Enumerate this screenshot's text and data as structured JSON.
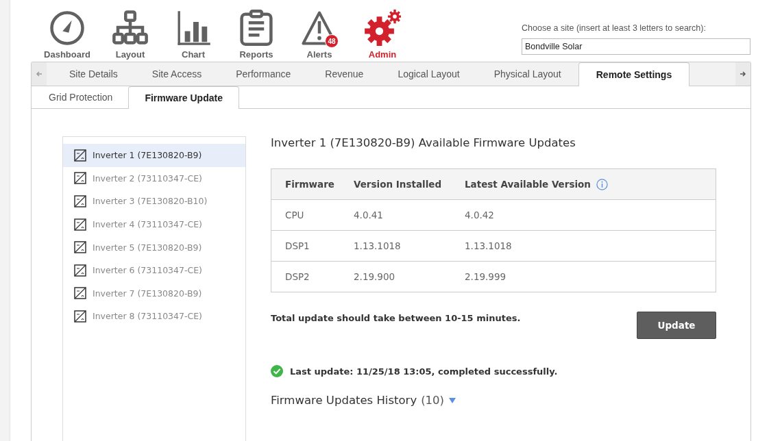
{
  "nav": [
    {
      "label": "Dashboard",
      "kind": "gauge",
      "selected": false
    },
    {
      "label": "Layout",
      "kind": "tree",
      "selected": false
    },
    {
      "label": "Chart",
      "kind": "bars",
      "selected": false
    },
    {
      "label": "Reports",
      "kind": "clipboard",
      "selected": false
    },
    {
      "label": "Alerts",
      "kind": "warning",
      "selected": false,
      "badge": "48"
    },
    {
      "label": "Admin",
      "kind": "gears",
      "selected": true
    }
  ],
  "site_search": {
    "label": "Choose a site (insert at least 3 letters to search):",
    "value": "Bondville Solar"
  },
  "tabs": [
    {
      "label": "Site Details",
      "selected": false
    },
    {
      "label": "Site Access",
      "selected": false
    },
    {
      "label": "Performance",
      "selected": false
    },
    {
      "label": "Revenue",
      "selected": false
    },
    {
      "label": "Logical Layout",
      "selected": false
    },
    {
      "label": "Physical Layout",
      "selected": false
    },
    {
      "label": "Remote Settings",
      "selected": true
    }
  ],
  "subtabs": [
    {
      "label": "Grid Protection",
      "selected": false
    },
    {
      "label": "Firmware Update",
      "selected": true
    }
  ],
  "inverters": [
    {
      "label": "Inverter 1 (7E130820-B9)",
      "selected": true
    },
    {
      "label": "Inverter 2 (73110347-CE)",
      "selected": false
    },
    {
      "label": "Inverter 3 (7E130820-B10)",
      "selected": false
    },
    {
      "label": "Inverter 4 (73110347-CE)",
      "selected": false
    },
    {
      "label": "Inverter 5 (7E130820-B9)",
      "selected": false
    },
    {
      "label": "Inverter 6 (73110347-CE)",
      "selected": false
    },
    {
      "label": "Inverter 7 (7E130820-B9)",
      "selected": false
    },
    {
      "label": "Inverter 8 (73110347-CE)",
      "selected": false
    }
  ],
  "detail_title": "Inverter 1 (7E130820-B9) Available Firmware Updates",
  "table": {
    "columns": [
      "Firmware",
      "Version Installed",
      "Latest Available Version"
    ],
    "rows": [
      [
        "CPU",
        "4.0.41",
        "4.0.42"
      ],
      [
        "DSP1",
        "1.13.1018",
        "1.13.1018"
      ],
      [
        "DSP2",
        "2.19.900",
        "2.19.999"
      ]
    ]
  },
  "duration_note": "Total update should take between 10-15 minutes.",
  "update_button": "Update",
  "last_update": "Last update: 11/25/18 13:05, completed successfully.",
  "history": {
    "title": "Firmware Updates History",
    "count": "(10)",
    "expanded": true
  }
}
